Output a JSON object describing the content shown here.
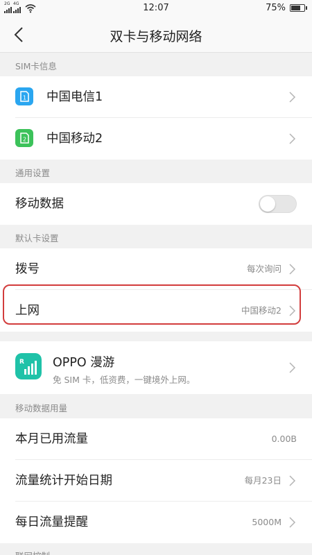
{
  "status_bar": {
    "sim1_network": "2G",
    "sim2_network": "4G",
    "time": "12:07",
    "battery_percent": "75%",
    "battery_level": 0.75
  },
  "nav": {
    "title": "双卡与移动网络",
    "back_icon": "back-arrow-icon"
  },
  "sections": {
    "sim_info": "SIM卡信息",
    "general": "通用设置",
    "default_card": "默认卡设置",
    "data_usage": "移动数据用量",
    "partial_next": "联网控制"
  },
  "sim_cards": [
    {
      "label": "中国电信1",
      "badge": "1",
      "color": "#2aa6f0"
    },
    {
      "label": "中国移动2",
      "badge": "2",
      "color": "#3cc25a"
    }
  ],
  "general": {
    "mobile_data_label": "移动数据",
    "mobile_data_on": false
  },
  "default_card": {
    "dial_label": "拨号",
    "dial_value": "每次询问",
    "internet_label": "上网",
    "internet_value": "中国移动2"
  },
  "oppo_roaming": {
    "title": "OPPO 漫游",
    "subtitle": "免 SIM 卡，低资费，一键境外上网。",
    "icon_letter": "R",
    "icon_color": "#1fc2a8"
  },
  "data_usage": {
    "month_used_label": "本月已用流量",
    "month_used_value": "0.00B",
    "start_date_label": "流量统计开始日期",
    "start_date_value": "每月23日",
    "daily_alert_label": "每日流量提醒",
    "daily_alert_value": "5000M"
  },
  "colors": {
    "highlight": "#d23c3c",
    "background": "#f1f1f1"
  }
}
